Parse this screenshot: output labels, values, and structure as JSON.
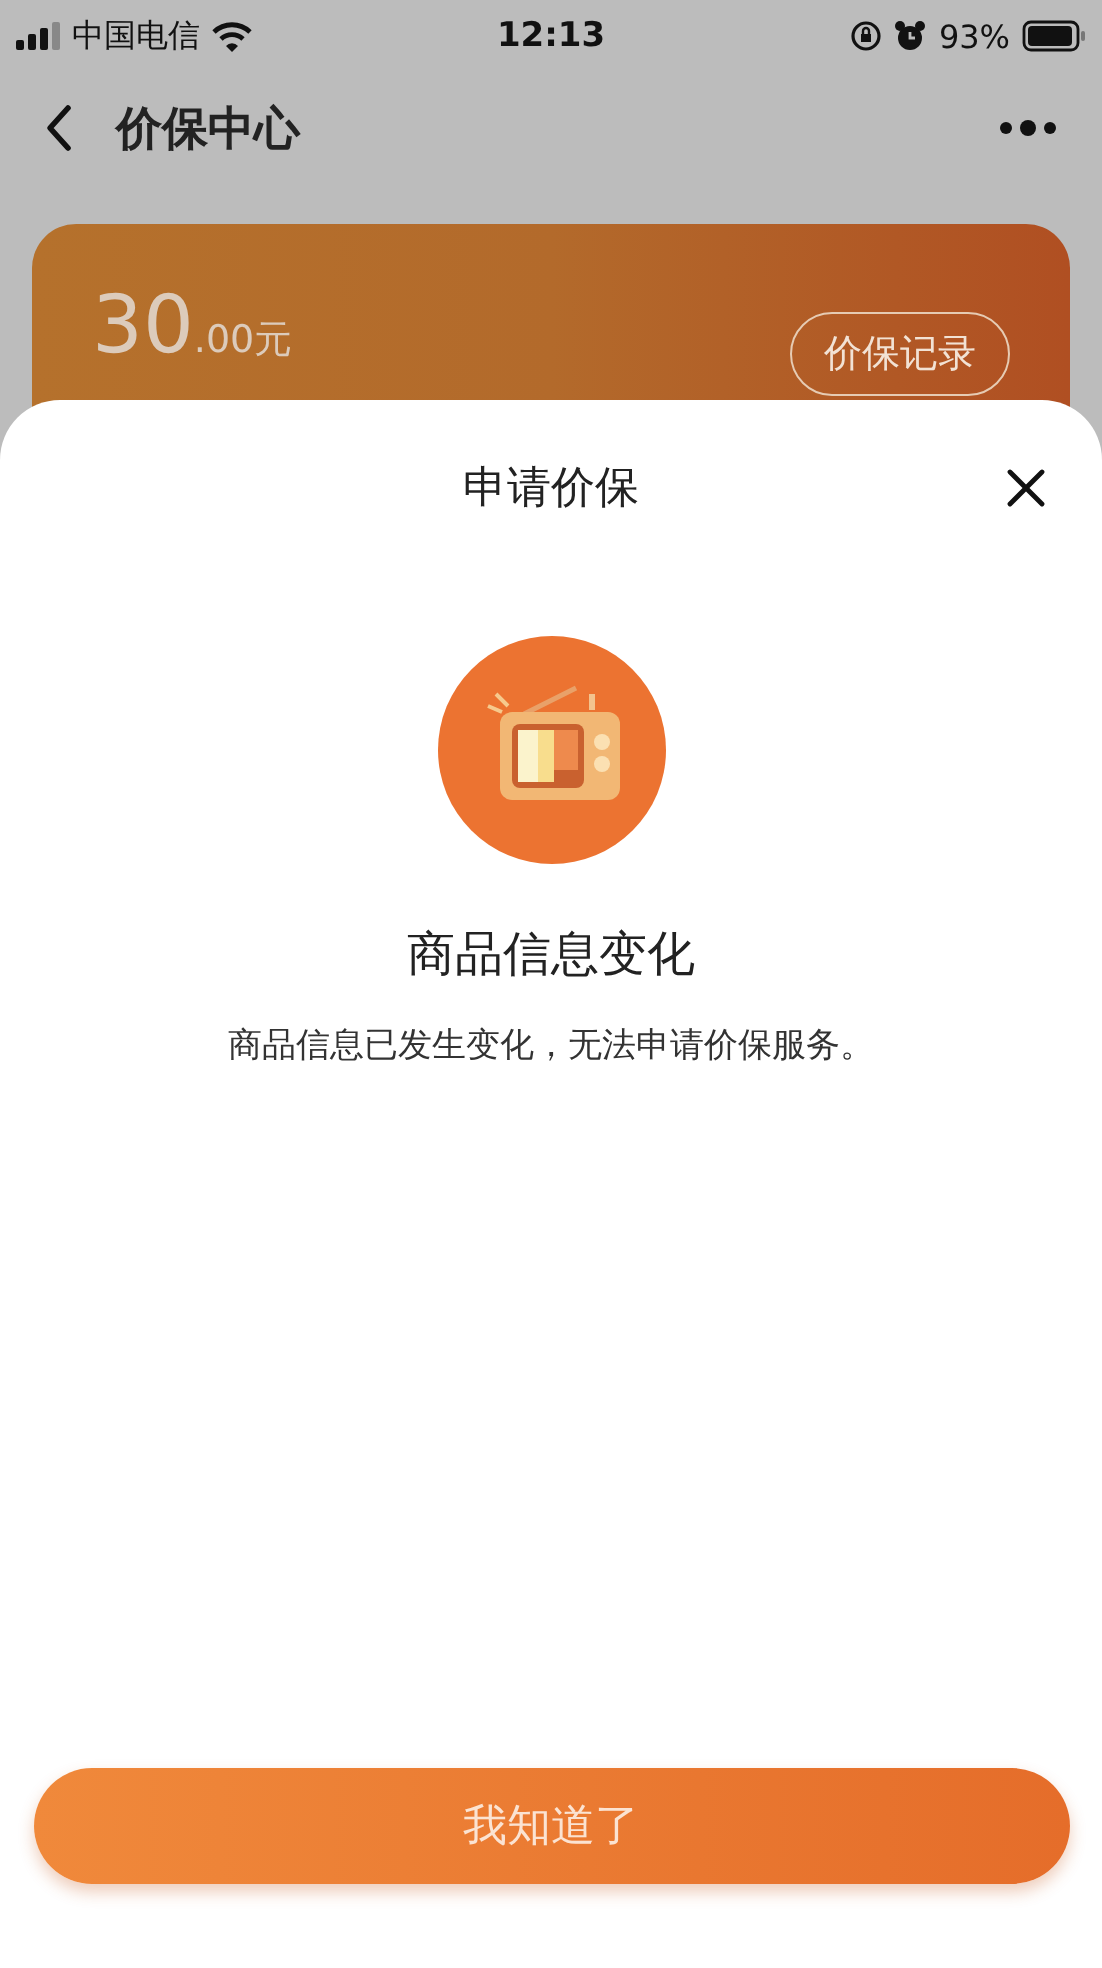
{
  "status_bar": {
    "carrier": "中国电信",
    "time": "12:13",
    "battery": "93%"
  },
  "nav": {
    "title": "价保中心"
  },
  "summary_card": {
    "amount": "30",
    "amount_fraction": ".00元",
    "records_button": "价保记录"
  },
  "sheet": {
    "title": "申请价保",
    "heading": "商品信息变化",
    "message": "商品信息已发生变化，无法申请价保服务。",
    "confirm_button": "我知道了"
  }
}
